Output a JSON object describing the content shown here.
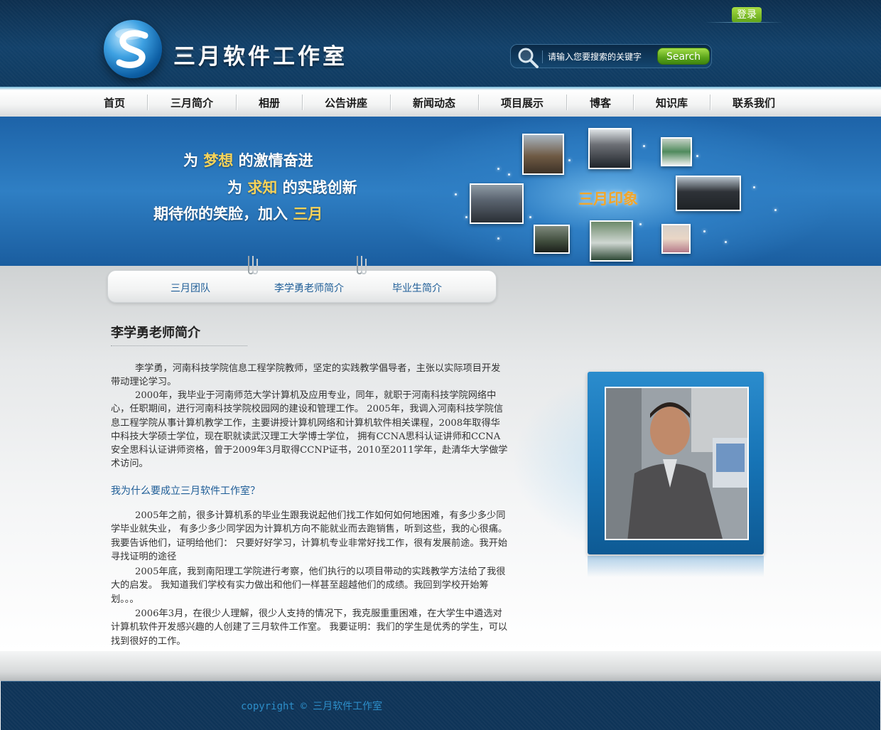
{
  "header": {
    "logo_text": "三月软件工作室",
    "login_label": "登录",
    "search_placeholder": "请输入您要搜索的关键字",
    "search_button_label": "Search"
  },
  "nav": {
    "items": [
      "首页",
      "三月简介",
      "相册",
      "公告讲座",
      "新闻动态",
      "项目展示",
      "博客",
      "知识库",
      "联系我们"
    ]
  },
  "banner": {
    "line1_pre": "为 ",
    "line1_hl": "梦想",
    "line1_post": " 的激情奋进",
    "line2_pre": "为 ",
    "line2_hl": "求知",
    "line2_post": " 的实践创新",
    "line3_pre": "期待你的笑脸，加入 ",
    "line3_hl": "三月",
    "gallery_label": "三月印象",
    "accent_color": "#f6d35a"
  },
  "subtabs": [
    "三月团队",
    "李学勇老师简介",
    "毕业生简介"
  ],
  "main": {
    "title": "李学勇老师简介",
    "paragraphs": [
      "李学勇，河南科技学院信息工程学院教师，坚定的实践教学倡导者，主张以实际项目开发带动理论学习。",
      "2000年，我毕业于河南师范大学计算机及应用专业，同年，就职于河南科技学院网络中心，任职期间，进行河南科技学院校园网的建设和管理工作。 2005年，我调入河南科技学院信息工程学院从事计算机教学工作，主要讲授计算机网络和计算机软件相关课程，2008年取得华中科技大学硕士学位，现在职就读武汉理工大学博士学位， 拥有CCNA思科认证讲师和CCNA安全思科认证讲师资格，曾于2009年3月取得CCNP证书，2010至2011学年，赴清华大学做学术访问。"
    ],
    "subheading": "我为什么要成立三月软件工作室？",
    "paragraphs2": [
      "2005年之前，很多计算机系的毕业生跟我说起他们找工作如何如何地困难，有多少多少同学毕业就失业， 有多少多少同学因为计算机方向不能就业而去跑销售，听到这些，我的心很痛。我要告诉他们，证明给他们： 只要好好学习，计算机专业非常好找工作，很有发展前途。我开始寻找证明的途径",
      "2005年底，我到南阳理工学院进行考察，他们执行的以项目带动的实践教学方法给了我很大的启发。 我知道我们学校有实力做出和他们一样甚至超越他们的成绩。我回到学校开始筹划。。。",
      "2006年3月，在很少人理解，很少人支持的情况下，我克服重重困难，在大学生中遴选对计算机软件开发感兴趣的人创建了三月软件工作室。 我要证明：我们的学生是优秀的学生，可以找到很好的工作。"
    ]
  },
  "footer": {
    "copyright_prefix": "copyright © ",
    "copyright_name": "三月软件工作室"
  }
}
